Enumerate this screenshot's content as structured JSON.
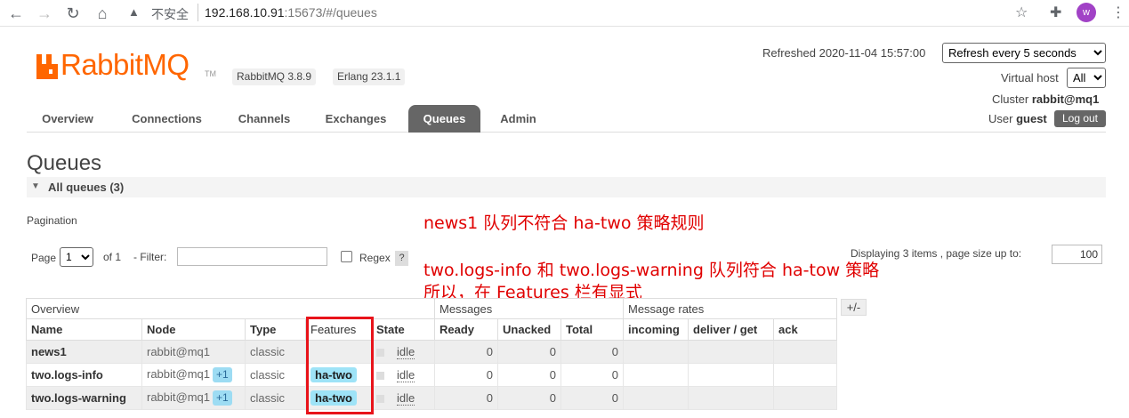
{
  "browser": {
    "insecure_label": "不安全",
    "url_host": "192.168.10.91",
    "url_path": ":15673/#/queues",
    "avatar_letter": "w"
  },
  "header": {
    "logo_text": "RabbitMQ",
    "logo_tm": "TM",
    "rabbitmq_version": "RabbitMQ 3.8.9",
    "erlang_version": "Erlang 23.1.1",
    "refreshed_label": "Refreshed 2020-11-04 15:57:00",
    "refresh_select": "Refresh every 5 seconds",
    "virtual_host_label": "Virtual host",
    "virtual_host_value": "All",
    "cluster_label": "Cluster",
    "cluster_value": "rabbit@mq1",
    "user_label": "User",
    "user_value": "guest",
    "logout_label": "Log out"
  },
  "tabs": [
    {
      "label": "Overview"
    },
    {
      "label": "Connections"
    },
    {
      "label": "Channels"
    },
    {
      "label": "Exchanges"
    },
    {
      "label": "Queues"
    },
    {
      "label": "Admin"
    }
  ],
  "page": {
    "title": "Queues",
    "section": "All queues (3)",
    "pagination_label": "Pagination",
    "page_label": "Page",
    "page_value": "1",
    "of_label": "of 1",
    "filter_label": "- Filter:",
    "regex_label": "Regex",
    "regex_help": "?",
    "displaying": "Displaying 3 items , page size up to:",
    "page_size": "100",
    "plus_minus": "+/-"
  },
  "annotations": {
    "line1": "news1 队列不符合 ha-two 策略规则",
    "line2": "two.logs-info 和 two.logs-warning 队列符合 ha-tow 策略",
    "line3": "所以，在 Features 栏有显式"
  },
  "table": {
    "group_overview": "Overview",
    "group_messages": "Messages",
    "group_rates": "Message rates",
    "columns": [
      "Name",
      "Node",
      "Type",
      "Features",
      "State",
      "Ready",
      "Unacked",
      "Total",
      "incoming",
      "deliver / get",
      "ack"
    ],
    "rows": [
      {
        "name": "news1",
        "node": "rabbit@mq1",
        "plus": "",
        "type": "classic",
        "feature": "",
        "state": "idle",
        "ready": "0",
        "unacked": "0",
        "total": "0"
      },
      {
        "name": "two.logs-info",
        "node": "rabbit@mq1",
        "plus": "+1",
        "type": "classic",
        "feature": "ha-two",
        "state": "idle",
        "ready": "0",
        "unacked": "0",
        "total": "0"
      },
      {
        "name": "two.logs-warning",
        "node": "rabbit@mq1",
        "plus": "+1",
        "type": "classic",
        "feature": "ha-two",
        "state": "idle",
        "ready": "0",
        "unacked": "0",
        "total": "0"
      }
    ]
  },
  "colors": {
    "brand": "#ff6600",
    "annotation": "#e00000",
    "feature_badge": "#9ee3f7",
    "highlight_box": "#e8131a"
  }
}
